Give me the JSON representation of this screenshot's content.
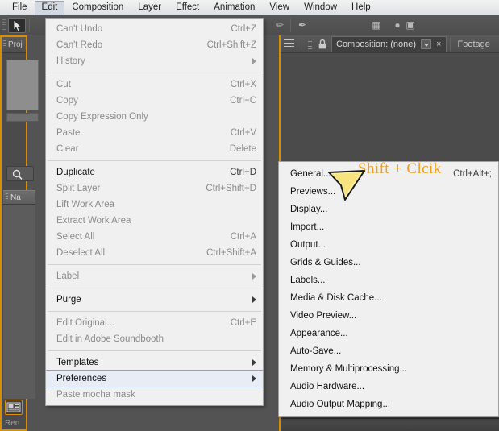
{
  "menubar": {
    "items": [
      {
        "label": "File",
        "active": false
      },
      {
        "label": "Edit",
        "active": true
      },
      {
        "label": "Composition",
        "active": false
      },
      {
        "label": "Layer",
        "active": false
      },
      {
        "label": "Effect",
        "active": false
      },
      {
        "label": "Animation",
        "active": false
      },
      {
        "label": "View",
        "active": false
      },
      {
        "label": "Window",
        "active": false
      },
      {
        "label": "Help",
        "active": false
      }
    ]
  },
  "project_panel": {
    "tab_label": "Proj",
    "column_header": "Na",
    "footer_label": "Ren",
    "search_icon": "search-icon",
    "footer_icon": "project-footage-icon"
  },
  "comp_panel": {
    "menu_icon": "panel-menu-icon",
    "lock_icon": "lock-icon",
    "tabs": [
      {
        "label": "Composition: (none)",
        "active": true,
        "has_caret": true,
        "has_close": true
      },
      {
        "label": "Footage",
        "active": false,
        "has_caret": false,
        "has_close": false
      }
    ],
    "close_glyph": "×"
  },
  "edit_menu": {
    "title": "Edit",
    "items": [
      {
        "label": "Can't Undo",
        "shortcut": "Ctrl+Z",
        "enabled": false,
        "submenu": false
      },
      {
        "label": "Can't Redo",
        "shortcut": "Ctrl+Shift+Z",
        "enabled": false,
        "submenu": false
      },
      {
        "label": "History",
        "shortcut": "",
        "enabled": false,
        "submenu": true
      },
      {
        "separator": true
      },
      {
        "label": "Cut",
        "shortcut": "Ctrl+X",
        "enabled": false,
        "submenu": false
      },
      {
        "label": "Copy",
        "shortcut": "Ctrl+C",
        "enabled": false,
        "submenu": false
      },
      {
        "label": "Copy Expression Only",
        "shortcut": "",
        "enabled": false,
        "submenu": false
      },
      {
        "label": "Paste",
        "shortcut": "Ctrl+V",
        "enabled": false,
        "submenu": false
      },
      {
        "label": "Clear",
        "shortcut": "Delete",
        "enabled": false,
        "submenu": false
      },
      {
        "separator": true
      },
      {
        "label": "Duplicate",
        "shortcut": "Ctrl+D",
        "enabled": true,
        "submenu": false
      },
      {
        "label": "Split Layer",
        "shortcut": "Ctrl+Shift+D",
        "enabled": false,
        "submenu": false
      },
      {
        "label": "Lift Work Area",
        "shortcut": "",
        "enabled": false,
        "submenu": false
      },
      {
        "label": "Extract Work Area",
        "shortcut": "",
        "enabled": false,
        "submenu": false
      },
      {
        "label": "Select All",
        "shortcut": "Ctrl+A",
        "enabled": false,
        "submenu": false
      },
      {
        "label": "Deselect All",
        "shortcut": "Ctrl+Shift+A",
        "enabled": false,
        "submenu": false
      },
      {
        "separator": true
      },
      {
        "label": "Label",
        "shortcut": "",
        "enabled": false,
        "submenu": true
      },
      {
        "separator": true
      },
      {
        "label": "Purge",
        "shortcut": "",
        "enabled": true,
        "submenu": true
      },
      {
        "separator": true
      },
      {
        "label": "Edit Original...",
        "shortcut": "Ctrl+E",
        "enabled": false,
        "submenu": false
      },
      {
        "label": "Edit in Adobe Soundbooth",
        "shortcut": "",
        "enabled": false,
        "submenu": false
      },
      {
        "separator": true
      },
      {
        "label": "Templates",
        "shortcut": "",
        "enabled": true,
        "submenu": true
      },
      {
        "label": "Preferences",
        "shortcut": "",
        "enabled": true,
        "submenu": true,
        "highlighted": true
      },
      {
        "label": "Paste mocha mask",
        "shortcut": "",
        "enabled": false,
        "submenu": false
      }
    ]
  },
  "preferences_menu": {
    "items": [
      {
        "label": "General...",
        "shortcut": "Ctrl+Alt+;",
        "enabled": true
      },
      {
        "label": "Previews...",
        "shortcut": "",
        "enabled": true
      },
      {
        "label": "Display...",
        "shortcut": "",
        "enabled": true
      },
      {
        "label": "Import...",
        "shortcut": "",
        "enabled": true
      },
      {
        "label": "Output...",
        "shortcut": "",
        "enabled": true
      },
      {
        "label": "Grids & Guides...",
        "shortcut": "",
        "enabled": true
      },
      {
        "label": "Labels...",
        "shortcut": "",
        "enabled": true
      },
      {
        "label": "Media & Disk Cache...",
        "shortcut": "",
        "enabled": true
      },
      {
        "label": "Video Preview...",
        "shortcut": "",
        "enabled": true
      },
      {
        "label": "Appearance...",
        "shortcut": "",
        "enabled": true
      },
      {
        "label": "Auto-Save...",
        "shortcut": "",
        "enabled": true
      },
      {
        "label": "Memory & Multiprocessing...",
        "shortcut": "",
        "enabled": true
      },
      {
        "label": "Audio Hardware...",
        "shortcut": "",
        "enabled": true
      },
      {
        "label": "Audio Output Mapping...",
        "shortcut": "",
        "enabled": true
      }
    ]
  },
  "annotation": {
    "text": "Shift + Clcik",
    "color": "#f0a01e",
    "cursor_icon": "arrow-cursor-pointer",
    "general_shortcut": "Ctrl+Alt+;"
  },
  "colors": {
    "accent_orange": "#d98d00",
    "menu_bg": "#f0f0f0",
    "panel_bg": "#4f4f4f",
    "annotation_orange": "#f0a01e",
    "highlight_blue": "#e8edf5"
  }
}
